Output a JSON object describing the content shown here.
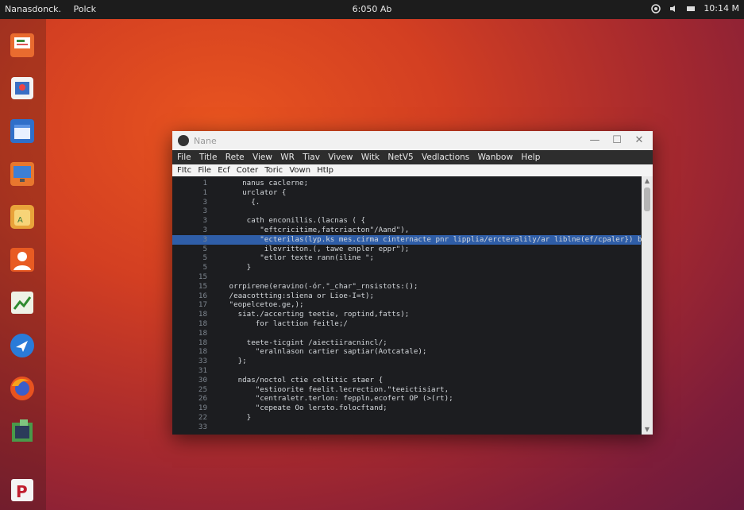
{
  "topbar": {
    "left_items": [
      "Nanasdonck.",
      "Polck"
    ],
    "clock": "6:050 Ab",
    "right_time": "10:14 M"
  },
  "dock": {
    "icons": [
      "presentation-icon",
      "files-icon",
      "calendar-icon",
      "monitor-icon",
      "software-center-icon",
      "contacts-icon",
      "chart-icon",
      "navigator-icon",
      "firefox-icon",
      "terminal-icon",
      "document-viewer-icon"
    ]
  },
  "window": {
    "title": "Nane",
    "controls": {
      "minimize": "—",
      "maximize": "☐",
      "close": "✕"
    },
    "menu_primary": [
      "File",
      "Title",
      "Rete",
      "View",
      "WR",
      "Tiav",
      "Vivew",
      "Witk",
      "NetV5",
      "Vedlactions",
      "Wanbow",
      "Help"
    ],
    "menu_secondary": [
      "FItc",
      "File",
      "Ecf",
      "Coter",
      "Toric",
      "Vown",
      "HtIp"
    ],
    "code_lines": [
      {
        "n": "1",
        "text": "    nanus caclerne;"
      },
      {
        "n": "1",
        "text": "    urclator {"
      },
      {
        "n": "3",
        "text": "      {."
      },
      {
        "n": "3",
        "text": ""
      },
      {
        "n": "3",
        "text": "     cath enconillis.(lacnas ( {"
      },
      {
        "n": "3",
        "text": "        \"eftcricitime,fatcriacton\"/Aand\"),"
      },
      {
        "n": "3",
        "text": "        \"ecterilas(lyp.ks mes.cirma cinternacte pnr lipplia/ercteralily/ar liblne(ef/cpaler}) b)]/]"
      },
      {
        "n": "5",
        "text": "         ilevritton.(, tawe enpler eppr\");"
      },
      {
        "n": "5",
        "text": "        \"etlor texte rann(iline \";"
      },
      {
        "n": "5",
        "text": "     }"
      },
      {
        "n": "15",
        "text": ""
      },
      {
        "n": "15",
        "text": " orrpirene(eravino(-ór.\"_char\"_rnsistots:();"
      },
      {
        "n": "16",
        "text": " /eaacottting:sliena or Lioe-I=t);"
      },
      {
        "n": "17",
        "text": " \"eopelcetoe.ge,);"
      },
      {
        "n": "18",
        "text": "   siat./accerting teetie, roptind,fatts);"
      },
      {
        "n": "18",
        "text": "       for lacttion feitle;/"
      },
      {
        "n": "18",
        "text": ""
      },
      {
        "n": "18",
        "text": "     teete-ticgint /aiectiiracnincl/;"
      },
      {
        "n": "18",
        "text": "       \"eralnlason cartier saptiar(Aotcatale);"
      },
      {
        "n": "33",
        "text": "   };"
      },
      {
        "n": "31",
        "text": ""
      },
      {
        "n": "30",
        "text": "   ndas/noctol ctie celtitic staer {"
      },
      {
        "n": "25",
        "text": "       \"estioorite feelit.lecrection.\"teeictisiart,"
      },
      {
        "n": "26",
        "text": "       \"centraletr.terlon: feppln,ecofert OP (>(rt);"
      },
      {
        "n": "19",
        "text": "       \"cepeate Oo lersto.folocftand;"
      },
      {
        "n": "22",
        "text": "     }"
      },
      {
        "n": "33",
        "text": ""
      }
    ],
    "highlighted_line": 6
  },
  "colors": {
    "highlight": "#2f5ea8",
    "editor_bg": "#1c1d20",
    "topbar_bg": "#1c1c1c"
  }
}
